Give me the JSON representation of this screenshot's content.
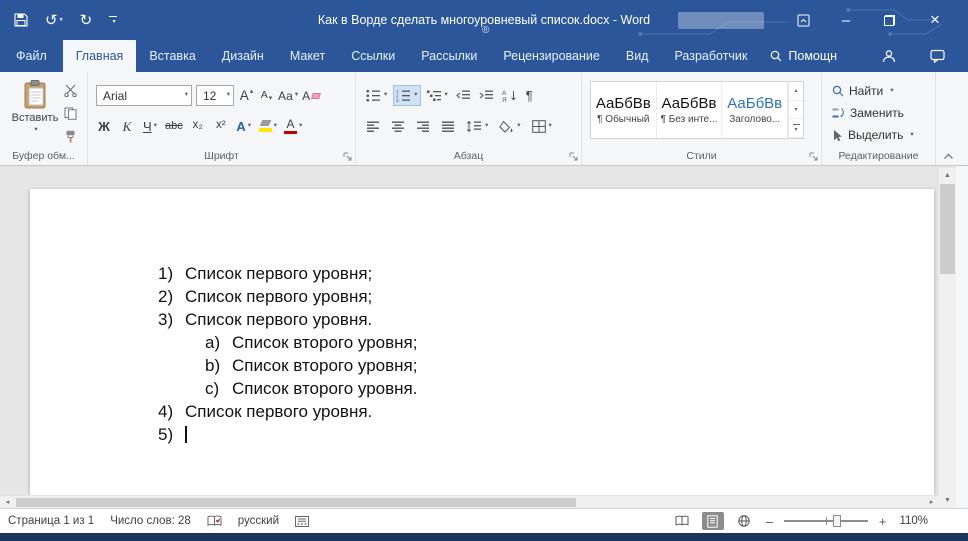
{
  "icons": {
    "undo": "↺",
    "redo": "↻",
    "dropdown": "▾",
    "up_small": "▴",
    "minimize": "–",
    "close": "×",
    "pilcrow": "¶",
    "scroll_up": "▲",
    "scroll_down": "▼",
    "scroll_left": "◂",
    "scroll_right": "▸",
    "registered": "®",
    "zoom_minus": "–",
    "zoom_plus": "+"
  },
  "titlebar": {
    "title": "Как в Ворде сделать многоуровневый список.docx - Word"
  },
  "tabs": {
    "file": "Файл",
    "items": [
      "Главная",
      "Вставка",
      "Дизайн",
      "Макет",
      "Ссылки",
      "Рассылки",
      "Рецензирование",
      "Вид",
      "Разработчик"
    ],
    "help": "Помощн"
  },
  "ribbon": {
    "clipboard": {
      "paste": "Вставить",
      "label": "Буфер обм..."
    },
    "font": {
      "family": "Arial",
      "size": "12",
      "grow": "А",
      "shrink": "А",
      "case": "Аа",
      "clear": "А",
      "bold": "Ж",
      "italic": "К",
      "underline": "Ч",
      "strike": "abc",
      "subscript": "x₂",
      "superscript": "x²",
      "effects": "А",
      "color": "А",
      "label": "Шрифт"
    },
    "paragraph": {
      "num1": "1",
      "num2": "2",
      "num3": "3",
      "sort_top": "А",
      "sort_bottom": "Я",
      "label": "Абзац"
    },
    "styles": {
      "label": "Стили",
      "items": [
        {
          "preview": "АаБбВв",
          "name": "¶ Обычный"
        },
        {
          "preview": "АаБбВв",
          "name": "¶ Без инте..."
        },
        {
          "preview": "АаБбВв",
          "name": "Заголово..."
        }
      ]
    },
    "editing": {
      "label": "Редактирование",
      "find": "Найти",
      "replace": "Заменить",
      "select": "Выделить"
    }
  },
  "document": {
    "list": [
      {
        "marker": "1)",
        "text": "Список первого уровня;"
      },
      {
        "marker": "2)",
        "text": "Список первого уровня;"
      },
      {
        "marker": "3)",
        "text": "Список первого уровня."
      },
      {
        "marker": "a)",
        "text": "Список второго уровня;"
      },
      {
        "marker": "b)",
        "text": "Список второго уровня;"
      },
      {
        "marker": "c)",
        "text": "Список второго уровня."
      },
      {
        "marker": "4)",
        "text": "Список первого уровня."
      },
      {
        "marker": "5)",
        "text": ""
      }
    ]
  },
  "statusbar": {
    "page": "Страница 1 из 1",
    "words": "Число слов: 28",
    "language": "русский",
    "zoom_level": "110%"
  }
}
